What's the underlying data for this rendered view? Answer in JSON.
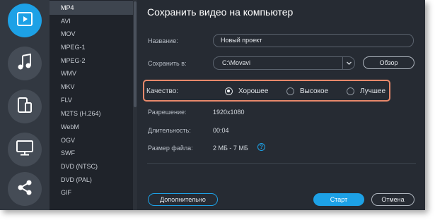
{
  "sidebar": {
    "icons": [
      "video-file-icon",
      "music-note-icon",
      "devices-icon",
      "monitor-icon",
      "share-icon"
    ],
    "active": "video-file-icon",
    "accent": "#1da1e6"
  },
  "formats": [
    "MP4",
    "AVI",
    "MOV",
    "MPEG-1",
    "MPEG-2",
    "WMV",
    "MKV",
    "FLV",
    "M2TS (H.264)",
    "WebM",
    "OGV",
    "SWF",
    "DVD (NTSC)",
    "DVD (PAL)",
    "GIF"
  ],
  "selected_format": "MP4",
  "main": {
    "title": "Сохранить видео на компьютер",
    "name_label": "Название:",
    "name_value": "Новый проект",
    "save_to_label": "Сохранить в:",
    "save_to_value": "C:\\Movavi",
    "browse_label": "Обзор",
    "quality_label": "Качество:",
    "quality_options": [
      "Хорошее",
      "Высокое",
      "Лучшее"
    ],
    "quality_selected": "Хорошее",
    "resolution_label": "Разрешение:",
    "resolution_value": "1920x1080",
    "duration_label": "Длительность:",
    "duration_value": "00:04",
    "filesize_label": "Размер файла:",
    "filesize_value": "2 МБ - 7 МБ",
    "help_glyph": "?"
  },
  "footer": {
    "advanced_label": "Дополнительно",
    "start_label": "Старт",
    "cancel_label": "Отмена"
  },
  "colors": {
    "highlight": "#e8896b",
    "accent": "#1da1e6"
  }
}
